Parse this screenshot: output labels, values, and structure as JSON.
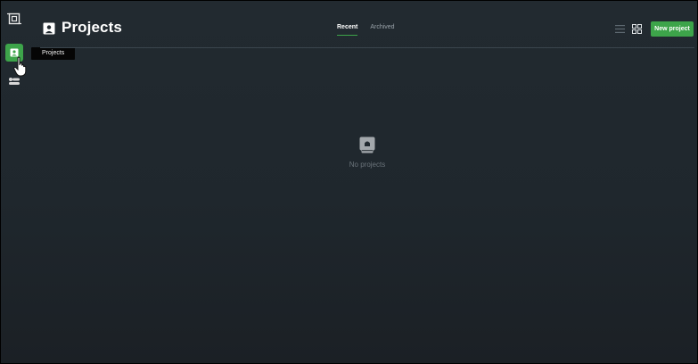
{
  "sidebar": {
    "tooltip": "Projects"
  },
  "header": {
    "title": "Projects",
    "tabs": [
      {
        "label": "Recent",
        "active": true
      },
      {
        "label": "Archived",
        "active": false
      }
    ],
    "new_button_label": "New project"
  },
  "empty_state": {
    "message": "No projects"
  },
  "colors": {
    "accent": "#3da44a",
    "background": "#222a30"
  }
}
